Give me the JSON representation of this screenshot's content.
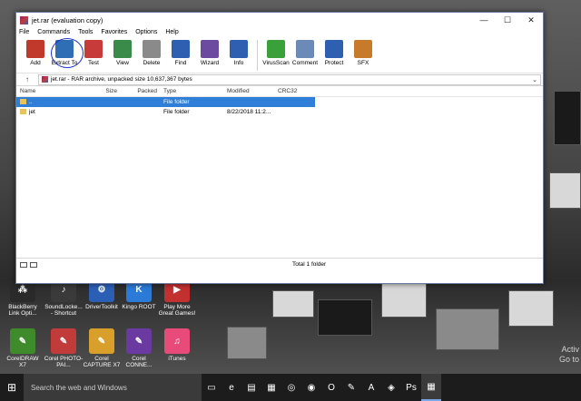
{
  "window": {
    "title": "jet.rar (evaluation copy)",
    "controls": {
      "minimize": "—",
      "maximize": "☐",
      "close": "✕"
    }
  },
  "menu": [
    "File",
    "Commands",
    "Tools",
    "Favorites",
    "Options",
    "Help"
  ],
  "toolbar": [
    {
      "label": "Add",
      "icon": "add-archive-icon",
      "color": "#c0392b"
    },
    {
      "label": "Extract To",
      "icon": "extract-to-icon",
      "color": "#2f6db5"
    },
    {
      "label": "Test",
      "icon": "test-icon",
      "color": "#c83b3b"
    },
    {
      "label": "View",
      "icon": "view-icon",
      "color": "#3a8a4a"
    },
    {
      "label": "Delete",
      "icon": "delete-icon",
      "color": "#8a8a8a"
    },
    {
      "label": "Find",
      "icon": "find-icon",
      "color": "#2f5fb0"
    },
    {
      "label": "Wizard",
      "icon": "wizard-icon",
      "color": "#6b4aa0"
    },
    {
      "label": "Info",
      "icon": "info-icon",
      "color": "#2f5fb0"
    },
    {
      "label": "VirusScan",
      "icon": "virusscan-icon",
      "color": "#3aa03a"
    },
    {
      "label": "Comment",
      "icon": "comment-icon",
      "color": "#6b8ab8"
    },
    {
      "label": "Protect",
      "icon": "protect-icon",
      "color": "#2f5fb0"
    },
    {
      "label": "SFX",
      "icon": "sfx-icon",
      "color": "#c87a2b"
    }
  ],
  "path": {
    "text": "jet.rar - RAR archive, unpacked size 10,637,367 bytes",
    "up_icon": "↑",
    "dropdown": "⌄"
  },
  "columns": [
    "Name",
    "Size",
    "Packed",
    "Type",
    "Modified",
    "CRC32"
  ],
  "rows": [
    {
      "name": "..",
      "size": "",
      "packed": "",
      "type": "File folder",
      "modified": "",
      "crc": ""
    },
    {
      "name": "jet",
      "size": "",
      "packed": "",
      "type": "File folder",
      "modified": "8/22/2018 11:2...",
      "crc": ""
    }
  ],
  "status": {
    "total": "Total 1 folder"
  },
  "desktop_icons": [
    {
      "label": "BlackBerry Link Opti...",
      "color": "#2a2a2a",
      "glyph": "⁂"
    },
    {
      "label": "SoundLocke... - Shortcut",
      "color": "#3a3a3a",
      "glyph": "♪"
    },
    {
      "label": "DriverToolkit",
      "color": "#2b5fb6",
      "glyph": "⚙"
    },
    {
      "label": "Kingo ROOT",
      "color": "#2b7ad8",
      "glyph": "K"
    },
    {
      "label": "Play More Great Games!",
      "color": "#c23030",
      "glyph": "▶"
    },
    {
      "label": "CorelDRAW X7",
      "color": "#3f8a2a",
      "glyph": "✎"
    },
    {
      "label": "Corel PHOTO-PAI...",
      "color": "#c23b3b",
      "glyph": "✎"
    },
    {
      "label": "Corel CAPTURE X7",
      "color": "#d8a02a",
      "glyph": "✎"
    },
    {
      "label": "Corel CONNE...",
      "color": "#6b3aa0",
      "glyph": "✎"
    },
    {
      "label": "iTunes",
      "color": "#e84a7a",
      "glyph": "♫"
    }
  ],
  "taskbar": {
    "search_placeholder": "Search the web and Windows",
    "icons": [
      {
        "name": "task-view-icon",
        "glyph": "▭"
      },
      {
        "name": "edge-icon",
        "glyph": "e"
      },
      {
        "name": "file-explorer-icon",
        "glyph": "▤"
      },
      {
        "name": "store-icon",
        "glyph": "▦"
      },
      {
        "name": "browser-icon",
        "glyph": "◎"
      },
      {
        "name": "firefox-icon",
        "glyph": "◉"
      },
      {
        "name": "opera-icon",
        "glyph": "O"
      },
      {
        "name": "corel-icon",
        "glyph": "✎"
      },
      {
        "name": "acrobat-icon",
        "glyph": "A"
      },
      {
        "name": "app-icon",
        "glyph": "◈"
      },
      {
        "name": "photoshop-icon",
        "glyph": "Ps"
      },
      {
        "name": "winrar-taskbar-icon",
        "glyph": "▦"
      }
    ]
  },
  "activate": {
    "line1": "Activ",
    "line2": "Go to"
  }
}
